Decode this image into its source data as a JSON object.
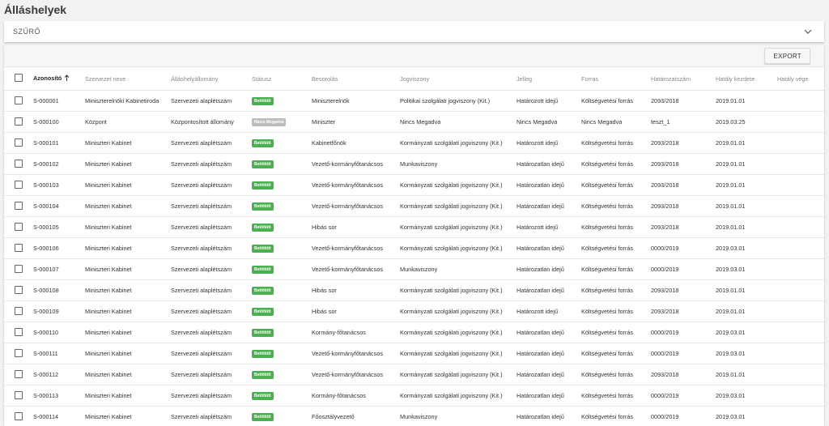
{
  "page": {
    "title": "Álláshelyek"
  },
  "filter": {
    "label": "SZŰRŐ"
  },
  "toolbar": {
    "export_label": "EXPORT"
  },
  "colors": {
    "success": "#4caf50",
    "neutral": "#bdbdbd"
  },
  "table": {
    "columns": [
      "Azonosító",
      "Szervezet neve",
      "Álláshelyállomány",
      "Státusz",
      "Besorolás",
      "Jogviszony",
      "Jelleg",
      "Forras",
      "Határozatszám",
      "Hatály kezdete",
      "Hatály vége"
    ],
    "sorted_column": 0,
    "rows": [
      {
        "id": "S-000001",
        "org": "Miniszterelnöki Kabinetiroda",
        "stock": "Szervezeti alaplétszám",
        "status": "Betöltött",
        "status_type": "success",
        "grade": "Miniszterelnök",
        "legal": "Politikai szolgálati jogviszony (Kit.)",
        "nature": "Határozott idejű",
        "source": "Költségvetési forrás",
        "decision": "2093/2018",
        "start": "2019.01.01",
        "end": ""
      },
      {
        "id": "S-000100",
        "org": "Központ",
        "stock": "Központosított állomány",
        "status": "Nincs Megadva",
        "status_type": "neutral",
        "grade": "Miniszter",
        "legal": "Nincs Megadva",
        "nature": "Nincs Megadva",
        "source": "Nincs Megadva",
        "decision": "teszt_1",
        "start": "2019.03.25",
        "end": ""
      },
      {
        "id": "S-000101",
        "org": "Miniszteri Kabinet",
        "stock": "Szervezeti alaplétszám",
        "status": "Betöltött",
        "status_type": "success",
        "grade": "Kabinetfőnök",
        "legal": "Kormányzati szolgálati jogviszony (Kit.)",
        "nature": "Határozott idejű",
        "source": "Költségvetési forrás",
        "decision": "2093/2018",
        "start": "2019.01.01",
        "end": ""
      },
      {
        "id": "S-000102",
        "org": "Miniszteri Kabinet",
        "stock": "Szervezeti alaplétszám",
        "status": "Betöltött",
        "status_type": "success",
        "grade": "Vezető-kormányfőtanácsos",
        "legal": "Munkaviszony",
        "nature": "Határozatlan idejű",
        "source": "Költségvetési forrás",
        "decision": "2093/2018",
        "start": "2019.01.01",
        "end": ""
      },
      {
        "id": "S-000103",
        "org": "Miniszteri Kabinet",
        "stock": "Szervezeti alaplétszám",
        "status": "Betöltött",
        "status_type": "success",
        "grade": "Vezető-kormányfőtanácsos",
        "legal": "Kormányzati szolgálati jogviszony (Kit.)",
        "nature": "Határozatlan idejű",
        "source": "Költségvetési forrás",
        "decision": "2093/2018",
        "start": "2019.01.01",
        "end": ""
      },
      {
        "id": "S-000104",
        "org": "Miniszteri Kabinet",
        "stock": "Szervezeti alaplétszám",
        "status": "Betöltött",
        "status_type": "success",
        "grade": "Vezető-kormányfőtanácsos",
        "legal": "Kormányzati szolgálati jogviszony (Kit.)",
        "nature": "Határozatlan idejű",
        "source": "Költségvetési forrás",
        "decision": "2093/2018",
        "start": "2019.01.01",
        "end": ""
      },
      {
        "id": "S-000105",
        "org": "Miniszteri Kabinet",
        "stock": "Szervezeti alaplétszám",
        "status": "Betöltött",
        "status_type": "success",
        "grade": "Hibás sor",
        "legal": "Kormányzati szolgálati jogviszony (Kit.)",
        "nature": "Határozott idejű",
        "source": "Költségvetési forrás",
        "decision": "2093/2018",
        "start": "2019.01.01",
        "end": ""
      },
      {
        "id": "S-000106",
        "org": "Miniszteri Kabinet",
        "stock": "Szervezeti alaplétszám",
        "status": "Betöltött",
        "status_type": "success",
        "grade": "Vezető-kormányfőtanácsos",
        "legal": "Kormányzati szolgálati jogviszony (Kit.)",
        "nature": "Határozatlan idejű",
        "source": "Költségvetési forrás",
        "decision": "0000/2019",
        "start": "2019.03.01",
        "end": ""
      },
      {
        "id": "S-000107",
        "org": "Miniszteri Kabinet",
        "stock": "Szervezeti alaplétszám",
        "status": "Betöltött",
        "status_type": "success",
        "grade": "Vezető-kormányfőtanácsos",
        "legal": "Munkaviszony",
        "nature": "Határozatlan idejű",
        "source": "Költségvetési forrás",
        "decision": "0000/2019",
        "start": "2019.03.01",
        "end": ""
      },
      {
        "id": "S-000108",
        "org": "Miniszteri Kabinet",
        "stock": "Szervezeti alaplétszám",
        "status": "Betöltött",
        "status_type": "success",
        "grade": "Hibás sor",
        "legal": "Kormányzati szolgálati jogviszony (Kit.)",
        "nature": "Határozatlan idejű",
        "source": "Költségvetési forrás",
        "decision": "2093/2018",
        "start": "2019.01.01",
        "end": ""
      },
      {
        "id": "S-000109",
        "org": "Miniszteri Kabinet",
        "stock": "Szervezeti alaplétszám",
        "status": "Betöltött",
        "status_type": "success",
        "grade": "Hibás sor",
        "legal": "Kormányzati szolgálati jogviszony (Kit.)",
        "nature": "Határozott idejű",
        "source": "Költségvetési forrás",
        "decision": "2093/2018",
        "start": "2019.01.01",
        "end": ""
      },
      {
        "id": "S-000110",
        "org": "Miniszteri Kabinet",
        "stock": "Szervezeti alaplétszám",
        "status": "Betöltött",
        "status_type": "success",
        "grade": "Kormány-főtanácsos",
        "legal": "Kormányzati szolgálati jogviszony (Kit.)",
        "nature": "Határozatlan idejű",
        "source": "Költségvetési forrás",
        "decision": "0000/2019",
        "start": "2019.03.01",
        "end": ""
      },
      {
        "id": "S-000111",
        "org": "Miniszteri Kabinet",
        "stock": "Szervezeti alaplétszám",
        "status": "Betöltött",
        "status_type": "success",
        "grade": "Vezető-kormányfőtanácsos",
        "legal": "Kormányzati szolgálati jogviszony (Kit.)",
        "nature": "Határozatlan idejű",
        "source": "Költségvetési forrás",
        "decision": "0000/2019",
        "start": "2019.03.01",
        "end": ""
      },
      {
        "id": "S-000112",
        "org": "Miniszteri Kabinet",
        "stock": "Szervezeti alaplétszám",
        "status": "Betöltött",
        "status_type": "success",
        "grade": "Vezető-kormányfőtanácsos",
        "legal": "Kormányzati szolgálati jogviszony (Kit.)",
        "nature": "Határozatlan idejű",
        "source": "Költségvetési forrás",
        "decision": "2093/2018",
        "start": "2019.01.01",
        "end": ""
      },
      {
        "id": "S-000113",
        "org": "Miniszteri Kabinet",
        "stock": "Szervezeti alaplétszám",
        "status": "Betöltött",
        "status_type": "success",
        "grade": "Kormány-főtanácsos",
        "legal": "Kormányzati szolgálati jogviszony (Kit.)",
        "nature": "Határozatlan idejű",
        "source": "Költségvetési forrás",
        "decision": "0000/2019",
        "start": "2019.03.01",
        "end": ""
      },
      {
        "id": "S-000114",
        "org": "Miniszteri Kabinet",
        "stock": "Szervezeti alaplétszám",
        "status": "Betöltött",
        "status_type": "success",
        "grade": "Főosztályvezető",
        "legal": "Munkaviszony",
        "nature": "Határozatlan idejű",
        "source": "Költségvetési forrás",
        "decision": "0000/2019",
        "start": "2019.03.01",
        "end": ""
      }
    ]
  }
}
